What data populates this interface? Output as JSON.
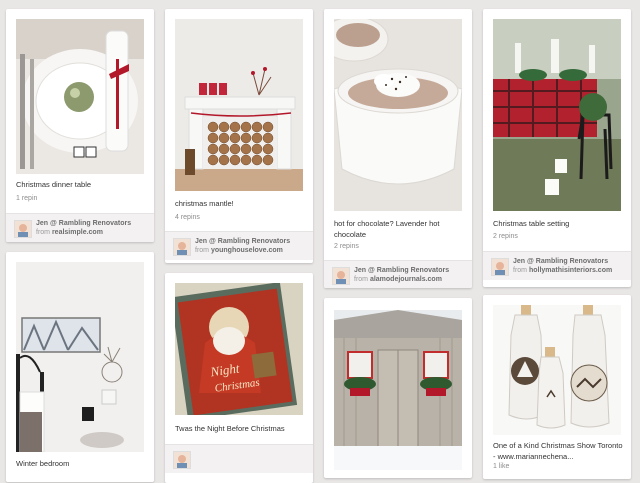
{
  "colors": {
    "background": "#e9e6e6",
    "card": "#ffffff",
    "attribution_bg": "#f3f1f1"
  },
  "pins": [
    {
      "image": "christmas-dinner-table-photo",
      "description": "Christmas dinner table",
      "repins": "1 repin",
      "pinner": "Jen @ Rambling Renovators",
      "from_prefix": "from",
      "source": "realsimple.com"
    },
    {
      "image": "christmas-mantle-photo",
      "description": "christmas mantle!",
      "repins": "4 repins",
      "pinner": "Jen @ Rambling Renovators",
      "from_prefix": "from",
      "source": "younghouselove.com"
    },
    {
      "image": "hot-chocolate-photo",
      "description": "hot for chocolate? Lavender hot chocolate",
      "repins": "2 repins",
      "pinner": "Jen @ Rambling Renovators",
      "from_prefix": "from",
      "source": "alamodejournals.com"
    },
    {
      "image": "christmas-table-setting-photo",
      "description": "Christmas table setting",
      "repins": "2 repins",
      "pinner": "Jen @ Rambling Renovators",
      "from_prefix": "from",
      "source": "hollymathisinteriors.com"
    },
    {
      "image": "winter-bedroom-photo",
      "description": "Winter bedroom"
    },
    {
      "image": "twas-the-night-book-photo",
      "description": "Twas the Night Before Christmas"
    },
    {
      "image": "shed-with-wreaths-photo"
    },
    {
      "image": "maple-syrup-jugs-photo",
      "description": "One of a Kind Christmas Show Toronto - www.mariannechena...",
      "repins": "1 like"
    }
  ]
}
